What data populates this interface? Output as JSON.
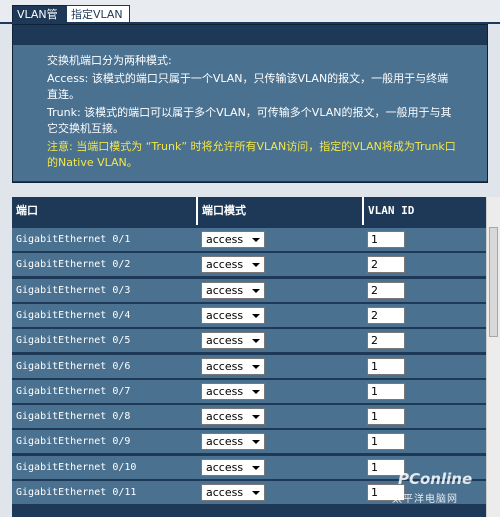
{
  "tabs": [
    {
      "label": "VLAN管理"
    },
    {
      "label": "指定VLAN"
    }
  ],
  "info": {
    "line1": "交换机端口分为两种模式:",
    "line2": "Access: 该模式的端口只属于一个VLAN，只传输该VLAN的报文，一般用于与终端直连。",
    "line3": "Trunk: 该模式的端口可以属于多个VLAN，可传输多个VLAN的报文，一般用于与其它交换机互接。",
    "note": "注意: 当端口模式为 “Trunk” 时将允许所有VLAN访问，指定的VLAN将成为Trunk口的Native VLAN。"
  },
  "table": {
    "headers": {
      "port": "端口",
      "mode": "端口模式",
      "vlan": "VLAN ID"
    },
    "rows": [
      {
        "port": "GigabitEthernet 0/1",
        "mode": "access",
        "vlan": "1"
      },
      {
        "port": "GigabitEthernet 0/2",
        "mode": "access",
        "vlan": "2"
      },
      {
        "port": "GigabitEthernet 0/3",
        "mode": "access",
        "vlan": "2"
      },
      {
        "port": "GigabitEthernet 0/4",
        "mode": "access",
        "vlan": "2"
      },
      {
        "port": "GigabitEthernet 0/5",
        "mode": "access",
        "vlan": "2"
      },
      {
        "port": "GigabitEthernet 0/6",
        "mode": "access",
        "vlan": "1"
      },
      {
        "port": "GigabitEthernet 0/7",
        "mode": "access",
        "vlan": "1"
      },
      {
        "port": "GigabitEthernet 0/8",
        "mode": "access",
        "vlan": "1"
      },
      {
        "port": "GigabitEthernet 0/9",
        "mode": "access",
        "vlan": "1"
      },
      {
        "port": "GigabitEthernet 0/10",
        "mode": "access",
        "vlan": "1"
      },
      {
        "port": "GigabitEthernet 0/11",
        "mode": "access",
        "vlan": "1"
      }
    ]
  },
  "watermark": {
    "logo": "PConline",
    "sub": "太平洋电脑网"
  },
  "colors": {
    "header": "#1d3957",
    "row": "#4a7190",
    "note": "#f2e64a"
  }
}
